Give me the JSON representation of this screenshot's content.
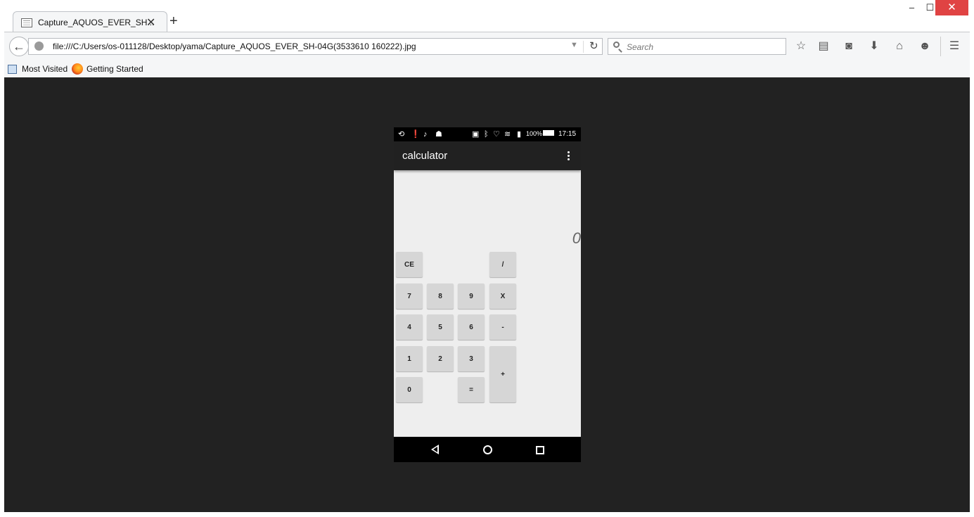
{
  "window": {
    "minimize": "‒",
    "maximize": "☐",
    "close": "✕"
  },
  "tab": {
    "title": "Capture_AQUOS_EVER_SH...",
    "close": "✕",
    "new_tab": "+"
  },
  "navbar": {
    "url": "file:///C:/Users/os-011128/Desktop/yama/Capture_AQUOS_EVER_SH-04G(3533610 160222).jpg",
    "search_placeholder": "Search",
    "icons": [
      "back-icon",
      "globe-icon",
      "dropdown-icon",
      "reload-icon",
      "search-icon",
      "bookmark-star-icon",
      "reading-list-icon",
      "pocket-icon",
      "download-icon",
      "home-icon",
      "chat-icon",
      "menu-icon"
    ]
  },
  "bookmarks": {
    "items": [
      {
        "label": "Most Visited",
        "icon": "most-visited-icon"
      },
      {
        "label": "Getting Started",
        "icon": "firefox-icon"
      }
    ]
  },
  "phone": {
    "status": {
      "battery": "100%",
      "time": "17:15"
    },
    "app_title": "calculator",
    "display": "0",
    "keys": {
      "ce": "CE",
      "div": "/",
      "k7": "7",
      "k8": "8",
      "k9": "9",
      "mul": "X",
      "k4": "4",
      "k5": "5",
      "k6": "6",
      "sub": "-",
      "k1": "1",
      "k2": "2",
      "k3": "3",
      "add": "+",
      "k0": "0",
      "eq": "="
    }
  },
  "colors": {
    "viewport_bg": "#222222",
    "phone_bg": "#eeeeee",
    "appbar_bg": "#212121",
    "key_bg": "#d6d6d6",
    "close_btn": "#e04343"
  }
}
